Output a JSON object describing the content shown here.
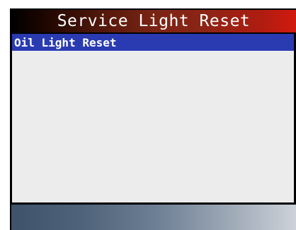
{
  "header": {
    "title": "Service Light Reset"
  },
  "menu": {
    "items": [
      {
        "label": "Oil Light Reset",
        "selected": true
      }
    ]
  },
  "colors": {
    "selection": "#2a3bb2",
    "list_background": "#ececec"
  }
}
